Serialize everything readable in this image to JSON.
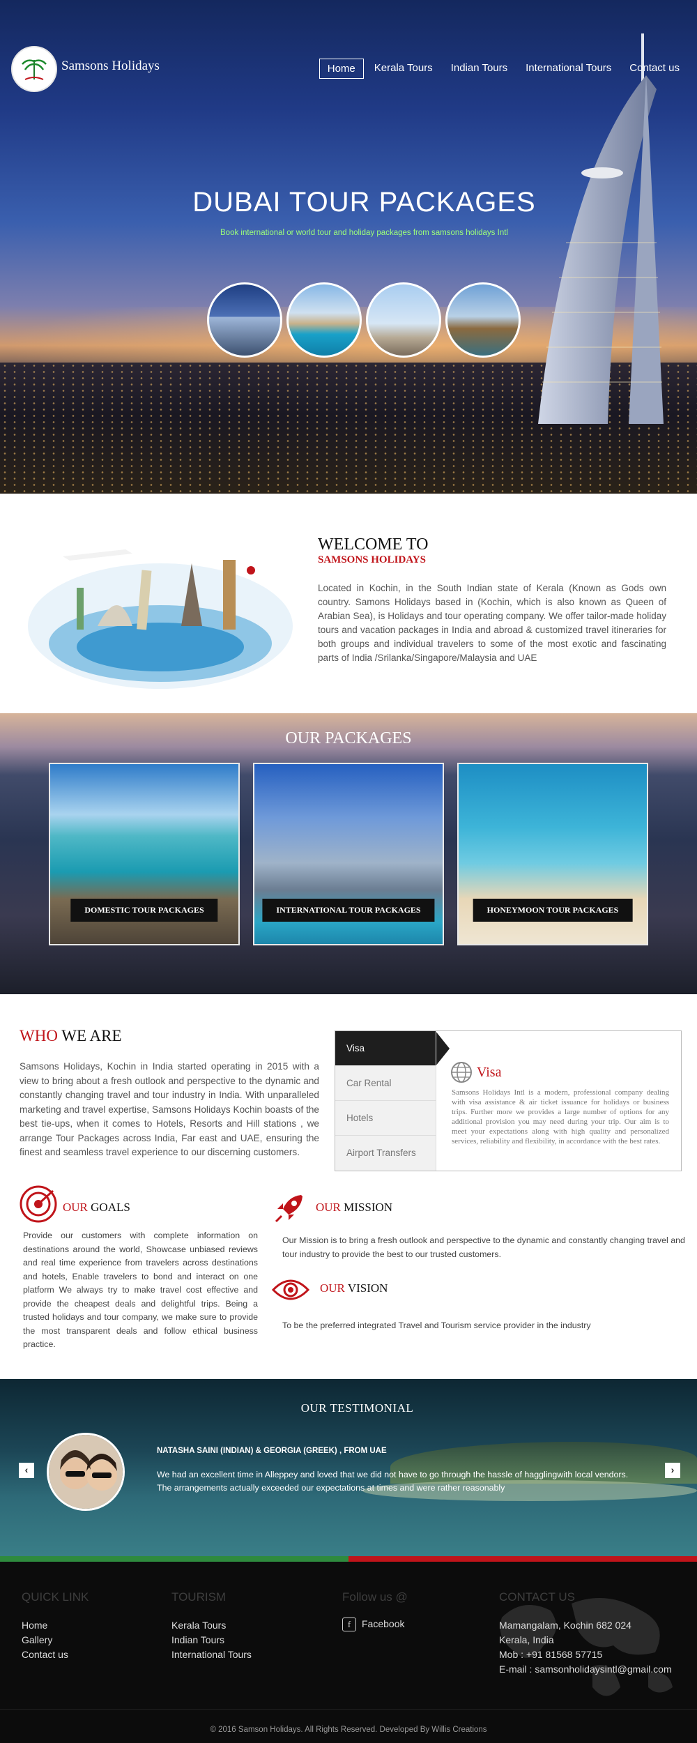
{
  "brand": {
    "name": "Samsons Holidays"
  },
  "nav": {
    "items": [
      "Home",
      "Kerala Tours",
      "Indian Tours",
      "International Tours",
      "Contact us"
    ],
    "active": "Home"
  },
  "hero": {
    "title": "DUBAI TOUR PACKAGES",
    "subtitle": "Book international or world tour and holiday packages from samsons holidays Intl"
  },
  "welcome": {
    "heading": "WELCOME TO",
    "subheading": "SAMSONS HOLIDAYS",
    "text": "Located in Kochin, in the South Indian state of Kerala (Known as Gods own country. Samons Holidays based in (Kochin, which is also known as Queen of Arabian Sea), is Holidays and tour operating company. We offer tailor-made holiday tours and vacation packages in India and abroad & customized travel itineraries for both groups and individual travelers to some of the most exotic and fascinating parts of India /Srilanka/Singapore/Malaysia and UAE"
  },
  "packages": {
    "title": "OUR PACKAGES",
    "items": [
      {
        "label": "DOMESTIC TOUR PACKAGES"
      },
      {
        "label": "INTERNATIONAL TOUR PACKAGES"
      },
      {
        "label": "HONEYMOON TOUR PACKAGES"
      }
    ]
  },
  "who": {
    "heading_red": "WHO",
    "heading_rest": " WE ARE",
    "text": "Samsons Holidays, Kochin in India started operating in 2015 with a view to bring about a fresh outlook and perspective to the dynamic and constantly changing travel and tour industry in India. With unparalleled marketing and travel expertise, Samsons Holidays Kochin boasts of the best tie-ups, when it comes to Hotels, Resorts and Hill stations , we arrange Tour Packages across India, Far east and UAE, ensuring the finest and seamless travel experience to our discerning customers."
  },
  "services": {
    "tabs": [
      "Visa",
      "Car Rental",
      "Hotels",
      "Airport Transfers"
    ],
    "active": "Visa",
    "panel_title": "Visa",
    "panel_text": "Samsons Holidays Intl is a modern, professional company dealing with visa assistance & air ticket issuance for holidays or business trips. Further more we provides a large number of options for any additional provision you may need during your trip. Our aim is to meet your expectations along with high quality and personalized services, reliability and flexibility, in accordance with the best rates."
  },
  "goals": {
    "red": "OUR",
    "rest": " GOALS",
    "text": "Provide our customers with complete information on destinations around the world, Showcase unbiased reviews and real time experience from travelers across destinations and hotels, Enable travelers to bond and interact on one platform We always try to make travel cost effective and provide the cheapest deals and delightful trips. Being a trusted holidays and tour company, we make sure to provide the most transparent deals and follow ethical business practice."
  },
  "mission": {
    "red": "OUR",
    "rest": " MISSION",
    "text": "Our Mission is to bring a fresh outlook and perspective to the dynamic and constantly changing travel and tour industry to provide the best to our trusted customers."
  },
  "vision": {
    "red": "OUR",
    "rest": " VISION",
    "text": "To be the preferred integrated Travel and Tourism service provider in the industry"
  },
  "testimonial": {
    "title": "OUR TESTIMONIAL",
    "name": "NATASHA SAINI (INDIAN) & GEORGIA (GREEK) , FROM UAE",
    "text": "We had an excellent time in Alleppey and loved that we did not have to go through the hassle of hagglingwith local vendors. The arrangements actually exceeded our expectations at times and were rather reasonably",
    "prev": "‹",
    "next": "›"
  },
  "footer": {
    "quick": {
      "heading": "QUICK LINK",
      "links": [
        "Home",
        "Gallery",
        "Contact us"
      ]
    },
    "tourism": {
      "heading": "TOURISM",
      "links": [
        "Kerala Tours",
        "Indian Tours",
        "International Tours"
      ]
    },
    "follow": {
      "heading": "Follow us @",
      "facebook": "Facebook"
    },
    "contact": {
      "heading": "CONTACT US",
      "lines": [
        "Mamangalam, Kochin 682 024",
        "Kerala, India",
        "Mob : +91 81568 57715",
        "E-mail : samsonholidaysintl@gmail.com"
      ]
    },
    "copyright": "© 2016 Samson Holidays. All Rights Reserved. Developed By Willis Creations"
  },
  "colors": {
    "accent": "#c0141a",
    "stripe_green": "#2e8b3e",
    "stripe_red": "#c0141a"
  }
}
